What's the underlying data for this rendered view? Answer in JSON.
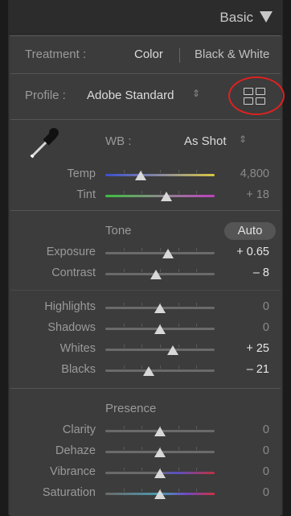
{
  "header": {
    "title": "Basic",
    "collapse_icon": "triangle-down-icon"
  },
  "treatment": {
    "label": "Treatment :",
    "color_option": "Color",
    "bw_option": "Black & White"
  },
  "profile": {
    "label": "Profile :",
    "value": "Adobe Standard",
    "stepper_icon": "updown-icon",
    "browser_icon": "grid-icon",
    "highlight_color": "#e02020"
  },
  "wb": {
    "label": "WB :",
    "value": "As Shot",
    "stepper_icon": "updown-icon",
    "dropper_icon": "eyedropper-icon"
  },
  "temp_tint": [
    {
      "name": "Temp",
      "value": "4,800",
      "position": 0.32,
      "gradient": "temp"
    },
    {
      "name": "Tint",
      "value": "+ 18",
      "position": 0.56,
      "gradient": "tint"
    }
  ],
  "tone": {
    "heading": "Tone",
    "auto_label": "Auto",
    "rows1": [
      {
        "name": "Exposure",
        "value": "+ 0.65",
        "position": 0.57
      },
      {
        "name": "Contrast",
        "value": "– 8",
        "position": 0.46
      }
    ],
    "rows2": [
      {
        "name": "Highlights",
        "value": "0",
        "position": 0.5
      },
      {
        "name": "Shadows",
        "value": "0",
        "position": 0.5
      },
      {
        "name": "Whites",
        "value": "+ 25",
        "position": 0.62
      },
      {
        "name": "Blacks",
        "value": "– 21",
        "position": 0.4
      }
    ]
  },
  "presence": {
    "heading": "Presence",
    "rows": [
      {
        "name": "Clarity",
        "value": "0",
        "position": 0.5,
        "gradient": "plain"
      },
      {
        "name": "Dehaze",
        "value": "0",
        "position": 0.5,
        "gradient": "plain"
      },
      {
        "name": "Vibrance",
        "value": "0",
        "position": 0.5,
        "gradient": "vib"
      },
      {
        "name": "Saturation",
        "value": "0",
        "position": 0.5,
        "gradient": "sat"
      }
    ]
  }
}
